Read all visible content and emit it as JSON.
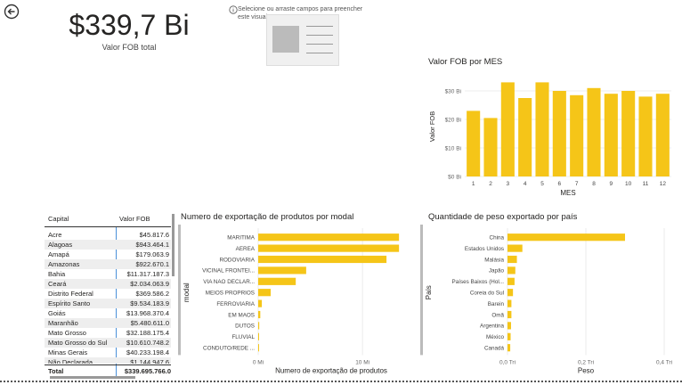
{
  "kpi": {
    "value": "$339,7 Bi",
    "label": "Valor FOB total"
  },
  "placeholder": {
    "text": "Selecione ou arraste campos para preencher este visual"
  },
  "table": {
    "headers": [
      "Capital",
      "Valor FOB"
    ],
    "rows": [
      [
        "Acre",
        "$45.817.6"
      ],
      [
        "Alagoas",
        "$943.464.1"
      ],
      [
        "Amapá",
        "$179.063.9"
      ],
      [
        "Amazonas",
        "$922.670.1"
      ],
      [
        "Bahia",
        "$11.317.187.3"
      ],
      [
        "Ceará",
        "$2.034.063.9"
      ],
      [
        "Distrito Federal",
        "$369.586.2"
      ],
      [
        "Espírito Santo",
        "$9.534.183.9"
      ],
      [
        "Goiás",
        "$13.968.370.4"
      ],
      [
        "Maranhão",
        "$5.480.611.0"
      ],
      [
        "Mato Grosso",
        "$32.188.175.4"
      ],
      [
        "Mato Grosso do Sul",
        "$10.610.748.2"
      ],
      [
        "Minas Gerais",
        "$40.233.198.4"
      ],
      [
        "Não Declarada",
        "$1.144.947.6"
      ]
    ],
    "total_label": "Total",
    "total_value": "$339.695.766.0"
  },
  "chart_data": [
    {
      "type": "bar",
      "title": "Valor FOB por MES",
      "xlabel": "MES",
      "ylabel": "Valor FOB",
      "categories": [
        "1",
        "2",
        "3",
        "4",
        "5",
        "6",
        "7",
        "8",
        "9",
        "10",
        "11",
        "12"
      ],
      "values": [
        23,
        20.5,
        33,
        27.5,
        33,
        30,
        28.5,
        31,
        29,
        30,
        28,
        29
      ],
      "yticks": [
        "$0 Bi",
        "$10 Bi",
        "$20 Bi",
        "$30 Bi"
      ],
      "ylim": [
        0,
        35
      ],
      "color": "#F5C518"
    },
    {
      "type": "bar",
      "orientation": "horizontal",
      "title": "Numero de exportação de produtos por modal",
      "xlabel": "Numero de exportação de produtos",
      "ylabel": "modal",
      "categories": [
        "MARITIMA",
        "AEREA",
        "RODOVIARIA",
        "VICINAL FRONTEI...",
        "VIA NAO DECLAR...",
        "MEIOS PROPRIOS",
        "FERROVIARIA",
        "EM MAOS",
        "DUTOS",
        "FLUVIAL",
        "CONDUTO/REDE ..."
      ],
      "values": [
        13.5,
        13.5,
        12.3,
        4.6,
        3.6,
        1.2,
        0.35,
        0.2,
        0.1,
        0.06,
        0.03
      ],
      "xticks": [
        "0 Mi",
        "10 Mi"
      ],
      "xlim": [
        0,
        14
      ],
      "color": "#F5C518"
    },
    {
      "type": "bar",
      "orientation": "horizontal",
      "title": "Quantidade de peso exportado por país",
      "xlabel": "Peso",
      "ylabel": "País",
      "categories": [
        "China",
        "Estados Unidos",
        "Malásia",
        "Japão",
        "Países Baixos (Hol...",
        "Coreia do Sul",
        "Barein",
        "Omã",
        "Argentina",
        "México",
        "Canadá"
      ],
      "values": [
        0.3,
        0.038,
        0.024,
        0.02,
        0.018,
        0.014,
        0.01,
        0.01,
        0.009,
        0.008,
        0.007
      ],
      "xticks": [
        "0,0 Tri",
        "0,2 Tri",
        "0,4 Tri"
      ],
      "xlim": [
        0,
        0.4
      ],
      "color": "#F5C518"
    }
  ],
  "icons": {
    "back": "back-arrow-icon",
    "info": "info-icon"
  }
}
